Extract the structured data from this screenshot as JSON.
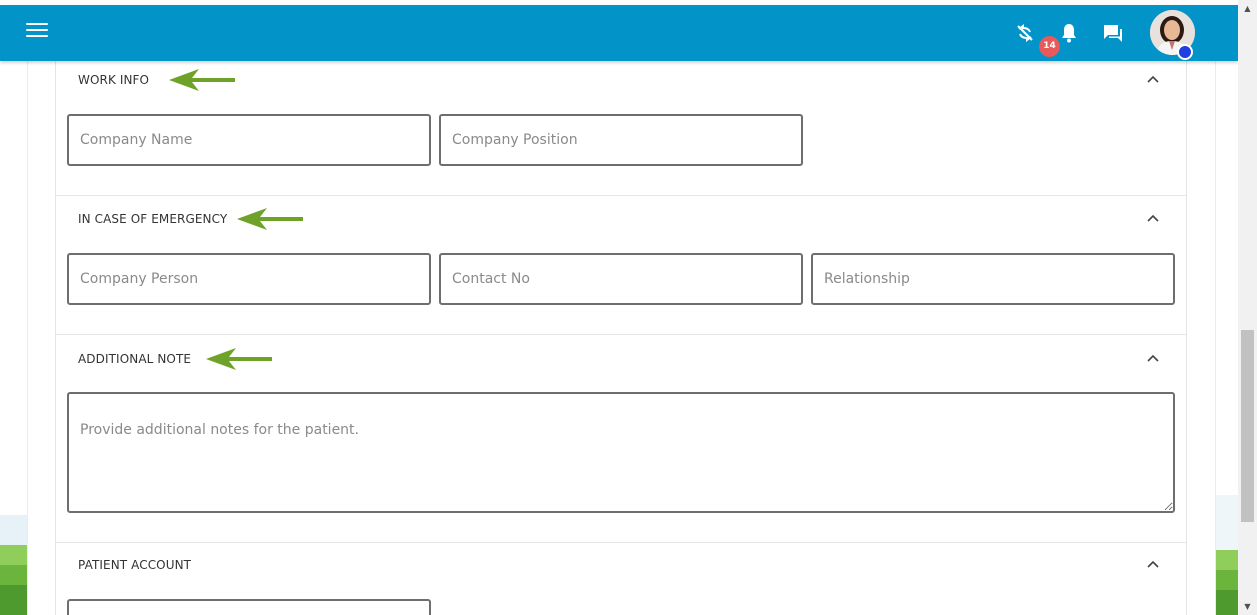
{
  "topbar": {
    "menu_icon": "hamburger-menu-icon",
    "sync_icon": "sync-off-icon",
    "notifications_icon": "bell-icon",
    "notifications_count": "14",
    "messages_icon": "chat-icon",
    "colors": {
      "bar": "#0293c8",
      "badge": "#e85a5a",
      "status": "#1f3fe0"
    }
  },
  "sections": {
    "work_info": {
      "title": "WORK INFO",
      "company_name_placeholder": "Company Name",
      "company_position_placeholder": "Company Position"
    },
    "emergency": {
      "title": "IN CASE OF EMERGENCY",
      "company_person_placeholder": "Company Person",
      "contact_no_placeholder": "Contact No",
      "relationship_placeholder": "Relationship"
    },
    "additional_note": {
      "title": "ADDITIONAL NOTE",
      "note_placeholder": "Provide additional notes for the patient."
    },
    "patient_account": {
      "title": "PATIENT ACCOUNT"
    }
  },
  "annotation_color": "#6fa229"
}
